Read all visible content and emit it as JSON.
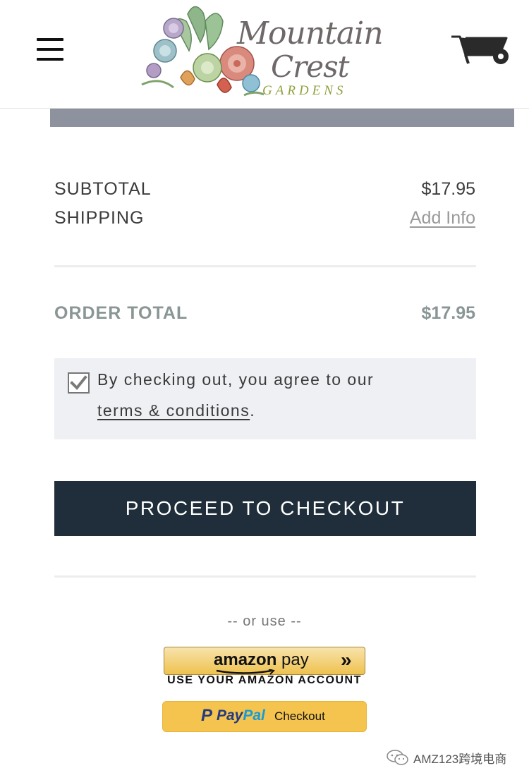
{
  "header": {
    "menu_icon": "hamburger-menu-icon",
    "logo": {
      "line1": "Mountain",
      "line2": "Crest",
      "line3": "GARDENS"
    },
    "cart_icon": "wheelbarrow-cart-icon"
  },
  "summary": {
    "subtotal_label": "SUBTOTAL",
    "subtotal_value": "$17.95",
    "shipping_label": "SHIPPING",
    "shipping_link": "Add Info",
    "order_total_label": "ORDER TOTAL",
    "order_total_value": "$17.95"
  },
  "agreement": {
    "checked": true,
    "text": "By checking out, you agree to our",
    "link": "terms & conditions",
    "suffix": "."
  },
  "checkout_button": "PROCEED TO CHECKOUT",
  "alt_payment": {
    "divider_text": "-- or use --",
    "amazon": {
      "brand": "amazon",
      "suffix": " pay",
      "arrows": "»",
      "subtext": "USE YOUR AMAZON ACCOUNT"
    },
    "paypal": {
      "p": "P",
      "pay": "Pay",
      "pal": "Pal",
      "label": "Checkout"
    }
  },
  "watermark": {
    "text": "AMZ123跨境电商"
  },
  "colors": {
    "button_dark": "#1f2e3a",
    "grey_bar": "#8e919e",
    "agree_bg": "#eef0f3",
    "total_text": "#8a9595",
    "paypal_yellow": "#f5c44e",
    "paypal_blue_dark": "#253b80",
    "paypal_blue_light": "#179bd7"
  }
}
